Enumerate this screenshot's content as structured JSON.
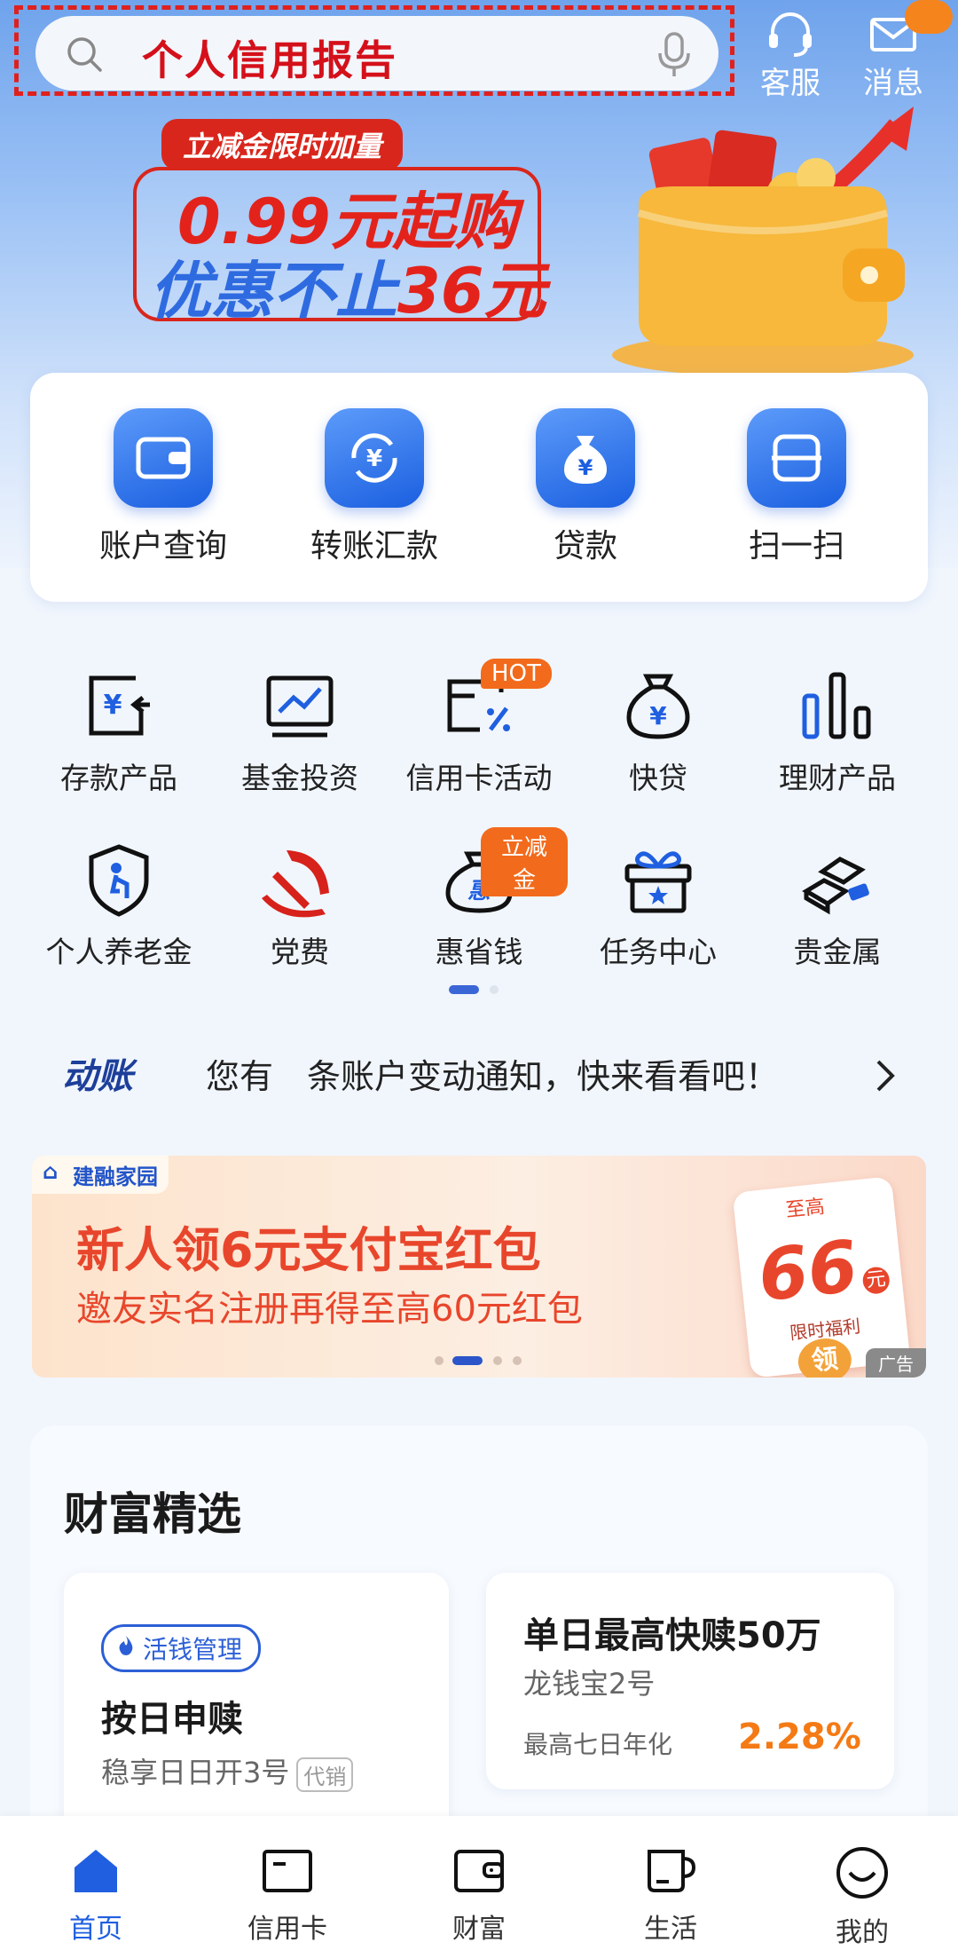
{
  "search": {
    "query": "个人信用报告"
  },
  "top_actions": [
    {
      "label": "客服"
    },
    {
      "label": "消息"
    }
  ],
  "banner": {
    "tag": "立减金限时加量",
    "line1": "0.99元起购",
    "line2_prefix": "优惠不止",
    "line2_highlight": "36元"
  },
  "main_actions": [
    {
      "label": "账户查询",
      "icon": "wallet-icon"
    },
    {
      "label": "转账汇款",
      "icon": "transfer-icon"
    },
    {
      "label": "贷款",
      "icon": "money-bag-icon"
    },
    {
      "label": "扫一扫",
      "icon": "scan-icon"
    }
  ],
  "grid": [
    {
      "label": "存款产品",
      "icon": "deposit-icon"
    },
    {
      "label": "基金投资",
      "icon": "fund-chart-icon"
    },
    {
      "label": "信用卡活动",
      "icon": "credit-card-discount-icon",
      "tag": "HOT"
    },
    {
      "label": "快贷",
      "icon": "money-bag-icon"
    },
    {
      "label": "理财产品",
      "icon": "bar-chart-icon"
    },
    {
      "label": "个人养老金",
      "icon": "pension-shield-icon"
    },
    {
      "label": "党费",
      "icon": "party-emblem-icon"
    },
    {
      "label": "惠省钱",
      "icon": "hui-bag-icon",
      "tag": "立减金"
    },
    {
      "label": "任务中心",
      "icon": "gift-icon"
    },
    {
      "label": "贵金属",
      "icon": "gold-bars-icon"
    }
  ],
  "notice": {
    "logo": "动账",
    "text": "您有　条账户变动通知，快来看看吧！"
  },
  "ad": {
    "brand": "建融家园",
    "title": "新人领6元支付宝红包",
    "subtitle": "邀友实名注册再得至高60元红包",
    "card_top": "至高",
    "card_value": "66",
    "card_unit": "元",
    "card_note": "限时福利",
    "card_button": "领",
    "ad_label": "广告"
  },
  "wealth": {
    "title": "财富精选",
    "card1": {
      "pill": "活钱管理",
      "heading": "按日申赎",
      "sub": "稳享日日开3号",
      "sub_tag": "代销"
    },
    "card2": {
      "heading": "单日最高快赎50万",
      "sub": "龙钱宝2号",
      "rate_label": "最高七日年化",
      "rate": "2.28%"
    }
  },
  "nav": [
    {
      "label": "首页",
      "icon": "home-icon",
      "active": true
    },
    {
      "label": "信用卡",
      "icon": "credit-card-icon"
    },
    {
      "label": "财富",
      "icon": "wallet-icon"
    },
    {
      "label": "生活",
      "icon": "cup-icon"
    },
    {
      "label": "我的",
      "icon": "smile-icon"
    }
  ],
  "colors": {
    "accent": "#1f5fe0",
    "red": "#e3231b",
    "orange": "#f47a15"
  }
}
